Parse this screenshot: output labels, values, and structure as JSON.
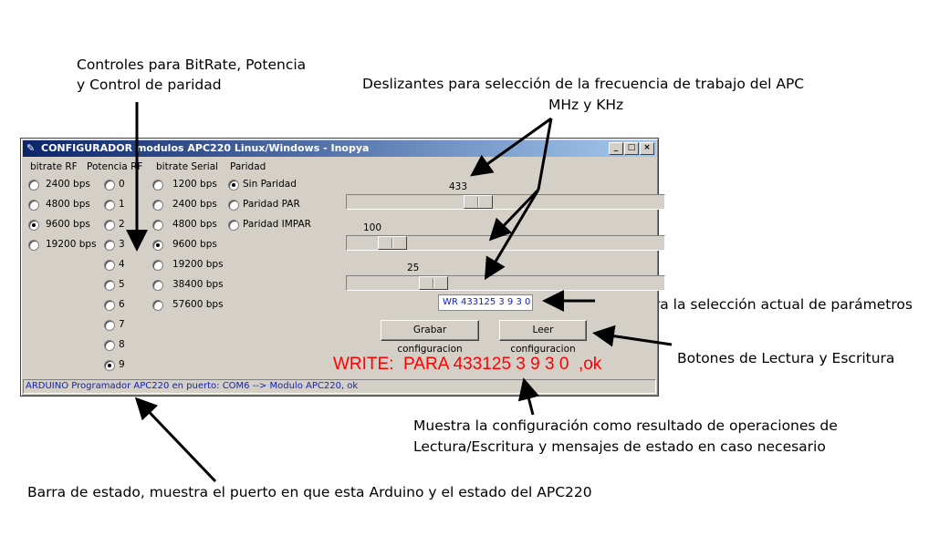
{
  "annotations": {
    "controls_line1": "Controles para BitRate, Potencia",
    "controls_line2": "y Control de paridad",
    "sliders_line1": "Deslizantes para selección de la frecuencia de trabajo del APC",
    "sliders_line2": "MHz y KHz",
    "params": "Muestra la selección actual de parámetros",
    "buttons": "Botones de Lectura y Escritura",
    "config_line1": "Muestra la configuración  como resultado de operaciones de",
    "config_line2": "Lectura/Escritura  y mensajes de estado en caso necesario",
    "statusbar": "Barra de estado, muestra el puerto en que esta Arduino y el estado del APC220"
  },
  "window": {
    "title": "CONFIGURADOR modulos APC220 Linux/Windows - Inopya",
    "minimize": "_",
    "maximize": "□",
    "close": "×"
  },
  "groups": {
    "bitrate_rf": {
      "header": "bitrate RF",
      "options": [
        "2400 bps",
        "4800 bps",
        "9600 bps",
        "19200 bps"
      ],
      "selected": "9600 bps"
    },
    "potencia_rf": {
      "header": "Potencia RF",
      "options": [
        "0",
        "1",
        "2",
        "3",
        "4",
        "5",
        "6",
        "7",
        "8",
        "9"
      ],
      "selected": "9"
    },
    "bitrate_serial": {
      "header": "bitrate Serial",
      "options": [
        "1200 bps",
        "2400 bps",
        "4800 bps",
        "9600 bps",
        "19200 bps",
        "38400 bps",
        "57600 bps"
      ],
      "selected": "9600 bps"
    },
    "paridad": {
      "header": "Paridad",
      "options": [
        "Sin Paridad",
        "Paridad PAR",
        "Paridad IMPAR"
      ],
      "selected": "Sin Paridad"
    }
  },
  "sliders": {
    "mhz": {
      "value": "433"
    },
    "khz_hundreds": {
      "value": "100"
    },
    "khz": {
      "value": "25"
    }
  },
  "params_display": "WR 433125 3 9 3 0",
  "buttons": {
    "write": "Grabar configuracion",
    "read": "Leer configuracion"
  },
  "message": "WRITE:  PARA 433125 3 9 3 0  ,ok",
  "statusbar": "ARDUINO Programador APC220 en puerto: COM6  --> Modulo APC220, ok",
  "colors": {
    "message": "#ff0000",
    "status_text": "#1020c0",
    "window_bg": "#d4d0c8",
    "titlebar": "#0a246a"
  }
}
